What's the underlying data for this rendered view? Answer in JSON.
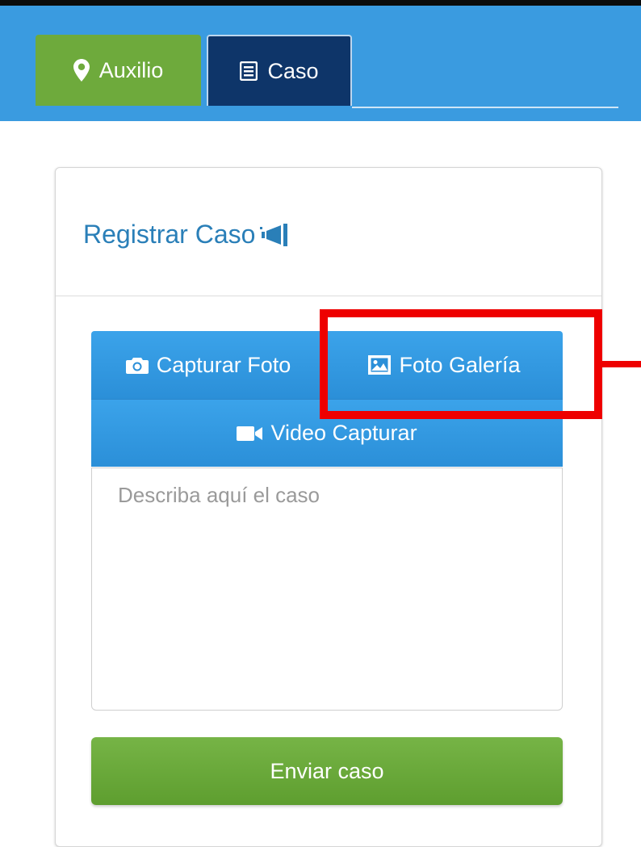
{
  "tabs": [
    {
      "label": "Auxilio",
      "icon": "map-pin-icon",
      "color": "#6eaa3c"
    },
    {
      "label": "Caso",
      "icon": "list-icon",
      "color": "#0e3569"
    }
  ],
  "header_color": "#3a9be0",
  "card": {
    "title": "Registrar Caso",
    "title_icon": "megaphone-icon",
    "title_color": "#2a7fb8"
  },
  "media_buttons": {
    "capture_photo": {
      "label": "Capturar Foto",
      "icon": "camera-icon"
    },
    "gallery_photo": {
      "label": "Foto Galería",
      "icon": "image-icon"
    },
    "capture_video": {
      "label": "Video Capturar",
      "icon": "video-camera-icon"
    },
    "color": "#3399e3"
  },
  "description": {
    "placeholder": "Describa aquí el caso",
    "value": ""
  },
  "submit": {
    "label": "Enviar caso",
    "color": "#6aa93c"
  },
  "highlight": {
    "target": "gallery_photo",
    "color": "#ee0000"
  }
}
